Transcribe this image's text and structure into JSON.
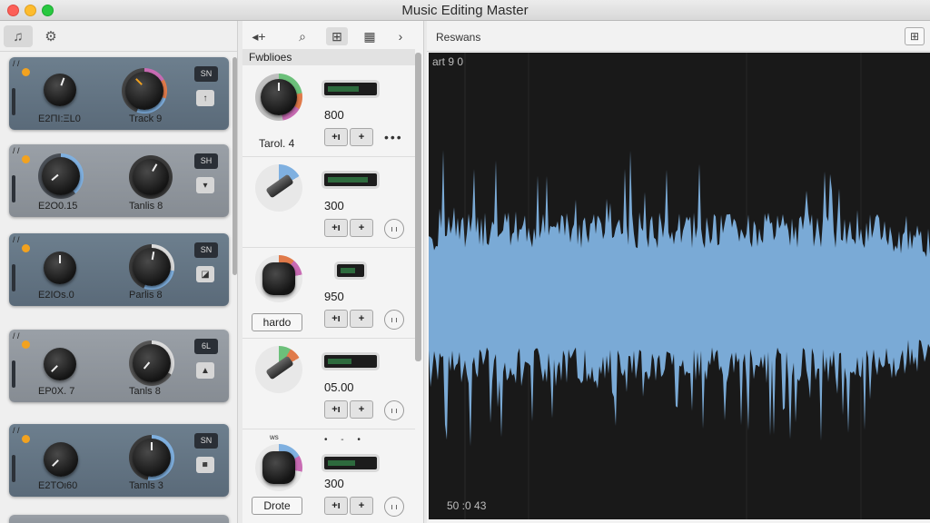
{
  "window": {
    "title": "Music Editing Master"
  },
  "colors": {
    "wave": "#7aaad6",
    "waveBg": "#191919",
    "accent": "#f2a21f"
  },
  "sidebar": {
    "tools": [
      {
        "icon": "tracks-icon"
      },
      {
        "icon": "gear-icon"
      }
    ],
    "tracks": [
      {
        "mini": "/ /",
        "label_a": "Ε2ΠΙ:ΞL0",
        "label_b": "Track 9",
        "badge": "SN",
        "button": "↑"
      },
      {
        "mini": "/ /",
        "label_a": "Ε2Ο0.15",
        "label_b": "Tanlis 8",
        "badge": "SH",
        "button": "▾"
      },
      {
        "mini": "/ /",
        "label_a": "Ε2ΙΟs.0",
        "label_b": "Parlis 8",
        "badge": "SN",
        "button": "◪"
      },
      {
        "mini": "/ /",
        "label_a": "ΕΡ0Χ. 7",
        "label_b": "Tanls 8",
        "badge": "6L",
        "button": "▲"
      },
      {
        "mini": "/ /",
        "label_a": "Ε2ΤΟι60",
        "label_b": "Tamls 3",
        "badge": "SN",
        "button": "◾"
      }
    ]
  },
  "effects": {
    "toolbar": [
      "◂+",
      "⌕",
      "⊞",
      "▦",
      "›"
    ],
    "header": "Fwblioes",
    "items": [
      {
        "label": "Tarol. 4",
        "value": "800",
        "minus": "+ı",
        "plus": "+",
        "extra": "•••"
      },
      {
        "label": "",
        "value": "300",
        "minus": "+ı",
        "plus": "+",
        "extra": "ı ı"
      },
      {
        "label": "hardo",
        "value": "950",
        "minus": "+ı",
        "plus": "+",
        "extra": "ı ı"
      },
      {
        "label": "",
        "value": "05.00",
        "minus": "+ı",
        "plus": "+",
        "extra": "ı ı"
      },
      {
        "label": "Drote",
        "value": "300",
        "minus": "+ı",
        "plus": "+",
        "extra": "ı ı",
        "top_mini": "ws",
        "top_dots": "• - •"
      }
    ]
  },
  "waveform": {
    "title": "Reswans",
    "top_label": "art 9 0",
    "bottom_label": "50 :0 43"
  }
}
